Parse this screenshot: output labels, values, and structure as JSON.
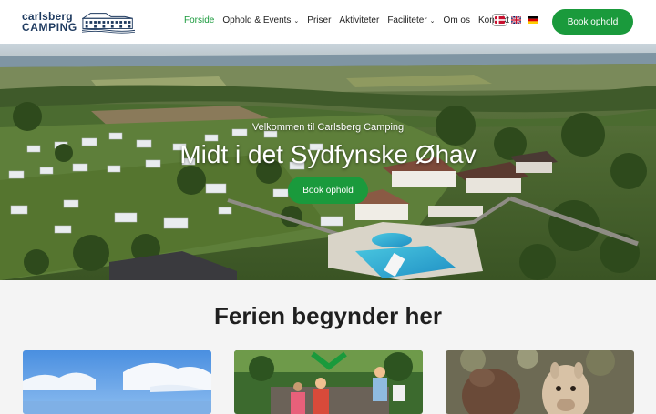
{
  "header": {
    "logo": {
      "line1": "carlsberg",
      "line2": "CAMPING"
    },
    "nav": [
      {
        "label": "Forside",
        "active": true,
        "dropdown": false
      },
      {
        "label": "Ophold & Events",
        "active": false,
        "dropdown": true
      },
      {
        "label": "Priser",
        "active": false,
        "dropdown": false
      },
      {
        "label": "Aktiviteter",
        "active": false,
        "dropdown": false
      },
      {
        "label": "Faciliteter",
        "active": false,
        "dropdown": true
      },
      {
        "label": "Om os",
        "active": false,
        "dropdown": false
      },
      {
        "label": "Kontakt",
        "active": false,
        "dropdown": false
      }
    ],
    "languages": [
      {
        "code": "da",
        "icon": "danish-flag-icon",
        "selected": true
      },
      {
        "code": "en",
        "icon": "uk-flag-icon",
        "selected": false
      },
      {
        "code": "de",
        "icon": "german-flag-icon",
        "selected": false
      }
    ],
    "book_button": "Book ophold"
  },
  "hero": {
    "subtitle": "Velkommen til Carlsberg Camping",
    "title": "Midt i det Sydfynske Øhav",
    "button": "Book ophold"
  },
  "section": {
    "title": "Ferien begynder her"
  },
  "colors": {
    "accent": "#1a9a3c",
    "brand": "#1e3a5f",
    "text": "#1f1f1f",
    "background": "#f4f4f4"
  }
}
